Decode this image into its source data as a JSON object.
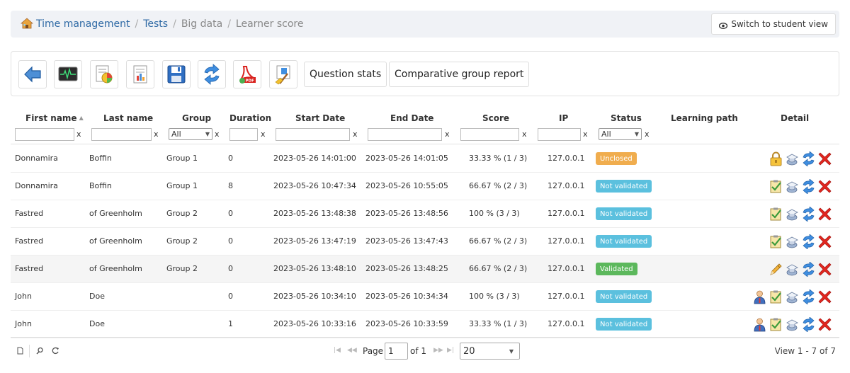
{
  "breadcrumb": {
    "items": [
      {
        "label": "Time management",
        "link": true
      },
      {
        "label": "Tests",
        "link": true
      },
      {
        "label": "Big data",
        "link": false
      },
      {
        "label": "Learner score",
        "link": false
      }
    ],
    "separator": "/"
  },
  "switch_view": {
    "label": "Switch to student view",
    "icon": "eye-icon"
  },
  "toolbar": {
    "icon_buttons": [
      "back-icon",
      "monitor-icon",
      "results-chart-icon",
      "report-icon",
      "save-icon",
      "refresh-icon",
      "pdf-export-icon",
      "clean-results-icon"
    ],
    "question_stats_label": "Question stats",
    "group_report_label": "Comparative group report"
  },
  "table": {
    "columns": [
      "First name",
      "Last name",
      "Group",
      "Duration",
      "Start Date",
      "End Date",
      "Score",
      "IP",
      "Status",
      "Learning path",
      "Detail"
    ],
    "filters": {
      "clear_label": "x",
      "group_select": "All",
      "status_select": "All"
    },
    "rows": [
      {
        "first": "Donnamira",
        "last": "Boffin",
        "group": "Group 1",
        "duration": "0",
        "start": "2023-05-26 14:01:00",
        "end": "2023-05-26 14:01:05",
        "score": "33.33 % (1 / 3)",
        "ip": "127.0.0.1",
        "status": "Unclosed",
        "status_color": "#f0ad4e",
        "actions": [
          "lock-icon",
          "hat-icon",
          "refresh-icon",
          "delete-icon"
        ],
        "alt": false
      },
      {
        "first": "Donnamira",
        "last": "Boffin",
        "group": "Group 1",
        "duration": "8",
        "start": "2023-05-26 10:47:34",
        "end": "2023-05-26 10:55:05",
        "score": "66.67 % (2 / 3)",
        "ip": "127.0.0.1",
        "status": "Not validated",
        "status_color": "#5bc0de",
        "actions": [
          "check-clipboard-icon",
          "hat-icon",
          "refresh-icon",
          "delete-icon"
        ],
        "alt": false
      },
      {
        "first": "Fastred",
        "last": "of Greenholm",
        "group": "Group 2",
        "duration": "0",
        "start": "2023-05-26 13:48:38",
        "end": "2023-05-26 13:48:56",
        "score": "100 % (3 / 3)",
        "ip": "127.0.0.1",
        "status": "Not validated",
        "status_color": "#5bc0de",
        "actions": [
          "check-clipboard-icon",
          "hat-icon",
          "refresh-icon",
          "delete-icon"
        ],
        "alt": false
      },
      {
        "first": "Fastred",
        "last": "of Greenholm",
        "group": "Group 2",
        "duration": "0",
        "start": "2023-05-26 13:47:19",
        "end": "2023-05-26 13:47:43",
        "score": "66.67 % (2 / 3)",
        "ip": "127.0.0.1",
        "status": "Not validated",
        "status_color": "#5bc0de",
        "actions": [
          "check-clipboard-icon",
          "hat-icon",
          "refresh-icon",
          "delete-icon"
        ],
        "alt": false
      },
      {
        "first": "Fastred",
        "last": "of Greenholm",
        "group": "Group 2",
        "duration": "0",
        "start": "2023-05-26 13:48:10",
        "end": "2023-05-26 13:48:25",
        "score": "66.67 % (2 / 3)",
        "ip": "127.0.0.1",
        "status": "Validated",
        "status_color": "#5cb85c",
        "actions": [
          "pencil-icon",
          "hat-icon",
          "refresh-icon",
          "delete-icon"
        ],
        "alt": true
      },
      {
        "first": "John",
        "last": "Doe",
        "group": "",
        "duration": "0",
        "start": "2023-05-26 10:34:10",
        "end": "2023-05-26 10:34:34",
        "score": "100 % (3 / 3)",
        "ip": "127.0.0.1",
        "status": "Not validated",
        "status_color": "#5bc0de",
        "actions": [
          "user-icon",
          "check-clipboard-icon",
          "hat-icon",
          "refresh-icon",
          "delete-icon"
        ],
        "alt": false
      },
      {
        "first": "John",
        "last": "Doe",
        "group": "",
        "duration": "1",
        "start": "2023-05-26 10:33:16",
        "end": "2023-05-26 10:33:59",
        "score": "33.33 % (1 / 3)",
        "ip": "127.0.0.1",
        "status": "Not validated",
        "status_color": "#5bc0de",
        "actions": [
          "user-icon",
          "check-clipboard-icon",
          "hat-icon",
          "refresh-icon",
          "delete-icon"
        ],
        "alt": false
      }
    ]
  },
  "pager": {
    "page_label": "Page",
    "page_value": "1",
    "of_label": "of 1",
    "rows_per_page": "20",
    "view_label": "View 1 - 7 of 7"
  },
  "colors": {
    "link": "#2f6aa5",
    "warning": "#f0ad4e",
    "info": "#5bc0de",
    "success": "#5cb85c",
    "danger": "#d9231f"
  }
}
